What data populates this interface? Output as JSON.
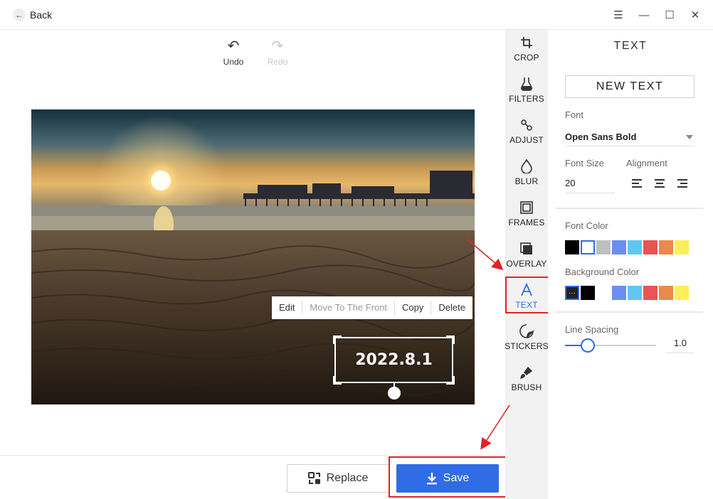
{
  "titlebar": {
    "back_label": "Back",
    "icons": [
      "arrow-left-icon",
      "menu-icon",
      "minimize-icon",
      "maximize-icon",
      "close-icon"
    ]
  },
  "history": {
    "undo_label": "Undo",
    "redo_label": "Redo"
  },
  "context_menu": {
    "items": [
      "Edit",
      "Move To The Front",
      "Copy",
      "Delete"
    ]
  },
  "text_layer": {
    "content": "2022.8.1"
  },
  "bottom": {
    "replace_label": "Replace",
    "save_label": "Save"
  },
  "tools": [
    {
      "label": "CROP",
      "icon": "crop-icon"
    },
    {
      "label": "FILTERS",
      "icon": "flask-icon"
    },
    {
      "label": "ADJUST",
      "icon": "adjust-icon"
    },
    {
      "label": "BLUR",
      "icon": "drop-icon"
    },
    {
      "label": "FRAMES",
      "icon": "frame-icon"
    },
    {
      "label": "OVERLAY",
      "icon": "overlay-icon"
    },
    {
      "label": "TEXT",
      "icon": "text-icon",
      "active": true
    },
    {
      "label": "STICKERS",
      "icon": "sticker-icon"
    },
    {
      "label": "BRUSH",
      "icon": "brush-icon"
    }
  ],
  "panel": {
    "title": "TEXT",
    "new_text_label": "NEW TEXT",
    "font_label": "Font",
    "font_value": "Open Sans Bold",
    "font_size_label": "Font Size",
    "font_size_value": "20",
    "alignment_label": "Alignment",
    "font_color_label": "Font Color",
    "font_colors": [
      "#000000",
      "#ffffff",
      "#bfbfbf",
      "#6b8ff0",
      "#62c6f2",
      "#e85454",
      "#ea8a4a",
      "#fbef5a"
    ],
    "font_color_selected": 1,
    "bg_color_label": "Background Color",
    "bg_colors": [
      "none",
      "#000000",
      "#ffffff",
      "#6b8ff0",
      "#62c6f2",
      "#e85454",
      "#ea8a4a",
      "#fbef5a"
    ],
    "bg_color_selected": 0,
    "line_spacing_label": "Line Spacing",
    "line_spacing_value": "1.0",
    "line_spacing_fraction": 0.25
  },
  "colors": {
    "accent": "#2f6ce5",
    "annotation_red": "#e02424"
  }
}
